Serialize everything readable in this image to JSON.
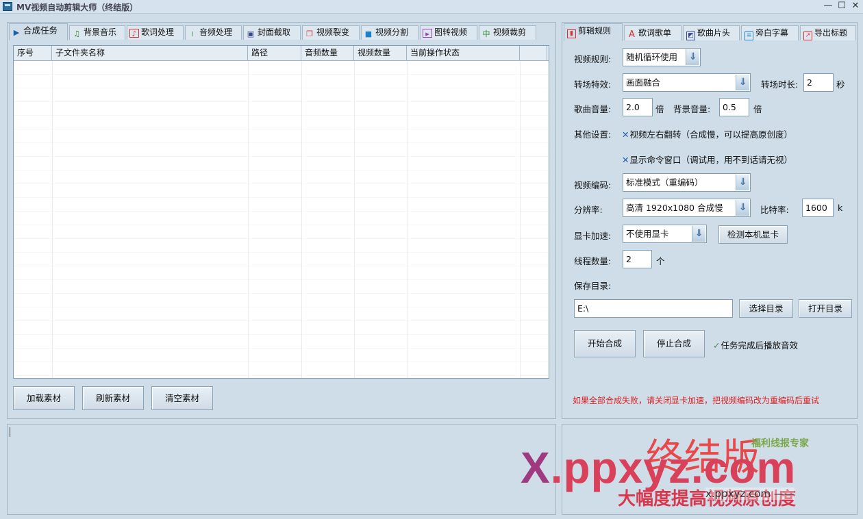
{
  "window": {
    "title": "MV视频自动剪辑大师（终结版）",
    "minimize": "—",
    "maximize": "☐",
    "close": "✕"
  },
  "left_tabs": [
    {
      "label": "合成任务",
      "icon": "play-icon",
      "glyph": "▶",
      "color": "#1d5ea8"
    },
    {
      "label": "背景音乐",
      "icon": "music-note-icon",
      "glyph": "♫",
      "color": "#2c8a2c"
    },
    {
      "label": "歌词处理",
      "icon": "lyrics-icon",
      "glyph": "♪",
      "color": "#d83030"
    },
    {
      "label": "音频处理",
      "icon": "waveform-icon",
      "glyph": "≀",
      "color": "#2c9a4c"
    },
    {
      "label": "封面截取",
      "icon": "image-icon",
      "glyph": "▣",
      "color": "#3a4a8a"
    },
    {
      "label": "视频裂变",
      "icon": "copy-icon",
      "glyph": "❐",
      "color": "#d83030"
    },
    {
      "label": "视频分割",
      "icon": "video-icon",
      "glyph": "■",
      "color": "#1d7fc8"
    },
    {
      "label": "图转视频",
      "icon": "slideshow-icon",
      "glyph": "▸",
      "color": "#9a3ab8"
    },
    {
      "label": "视频裁剪",
      "icon": "crop-icon",
      "glyph": "中",
      "color": "#2c8a2c"
    }
  ],
  "table": {
    "columns": [
      "序号",
      "子文件夹名称",
      "路径",
      "音频数量",
      "视频数量",
      "当前操作状态",
      ""
    ],
    "rows": []
  },
  "left_buttons": {
    "load": "加载素材",
    "refresh": "刷新素材",
    "clear": "清空素材"
  },
  "right_tabs": [
    {
      "label": "剪辑规则",
      "icon": "clip-icon",
      "glyph": "▮",
      "color": "#d83030"
    },
    {
      "label": "歌词歌单",
      "icon": "text-icon",
      "glyph": "A",
      "color": "#d83030"
    },
    {
      "label": "歌曲片头",
      "icon": "image-icon",
      "glyph": "◩",
      "color": "#3a4a8a"
    },
    {
      "label": "旁白字幕",
      "icon": "document-icon",
      "glyph": "≡",
      "color": "#1d7fc8"
    },
    {
      "label": "导出标题",
      "icon": "export-icon",
      "glyph": "↗",
      "color": "#d83030"
    }
  ],
  "settings": {
    "video_rule_label": "视频规则:",
    "video_rule_value": "随机循环使用",
    "transition_label": "转场特效:",
    "transition_value": "画面融合",
    "transition_duration_label": "转场时长:",
    "transition_duration_value": "2",
    "transition_duration_unit": "秒",
    "song_volume_label": "歌曲音量:",
    "song_volume_value": "2.0",
    "song_volume_unit": "倍",
    "bg_volume_label": "背景音量:",
    "bg_volume_value": "0.5",
    "bg_volume_unit": "倍",
    "other_label": "其他设置:",
    "option_flip": "视频左右翻转（合成慢，可以提高原创度）",
    "option_console": "显示命令窗口（调试用，用不到话请无视）",
    "encoding_label": "视频编码:",
    "encoding_value": "标准模式（重编码）",
    "resolution_label": "分辨率:",
    "resolution_value": "高清 1920x1080 合成慢",
    "bitrate_label": "比特率:",
    "bitrate_value": "1600",
    "bitrate_unit": "k",
    "gpu_label": "显卡加速:",
    "gpu_value": "不使用显卡",
    "detect_gpu": "检测本机显卡",
    "threads_label": "线程数量:",
    "threads_value": "2",
    "threads_unit": "个",
    "save_dir_label": "保存目录:",
    "save_dir_value": "E:\\",
    "choose_dir": "选择目录",
    "open_dir": "打开目录",
    "start": "开始合成",
    "stop": "停止合成",
    "play_sound_option": "任务完成后播放音效",
    "warning": "如果全部合成失败，请关闭显卡加速，把视频编码改为重编码后重试"
  },
  "watermark": {
    "edition": "终结版",
    "badge": "福利线报专家",
    "domain_x": "X",
    "domain_rest": ".ppxyz.com",
    "slogan": "大幅度提高视频原创度",
    "url": "x.ppxyz.com ——"
  }
}
